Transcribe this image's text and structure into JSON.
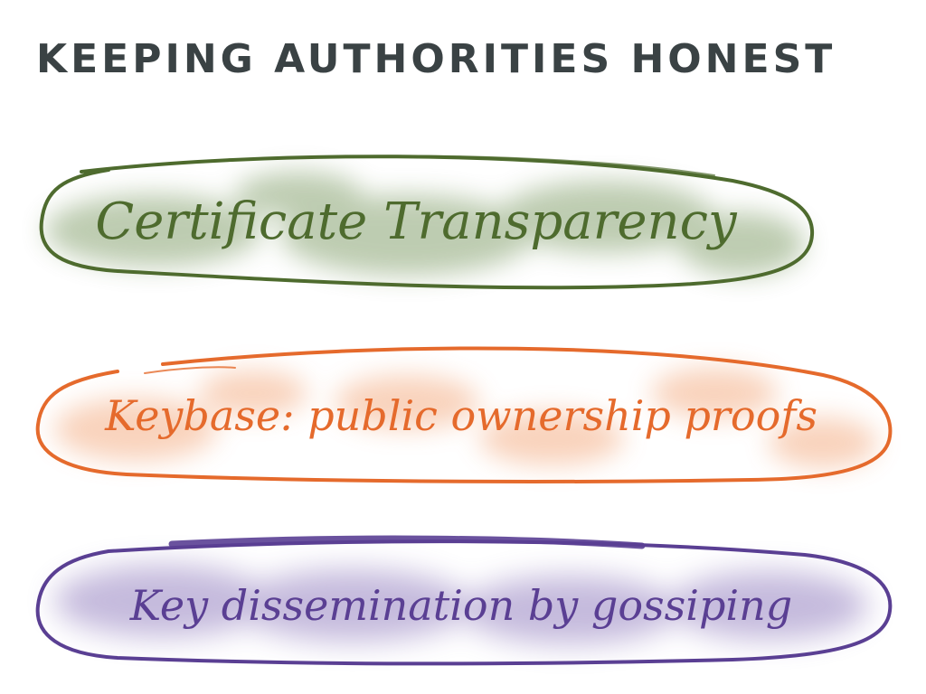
{
  "title": "KEEPING AUTHORITIES HONEST",
  "items": [
    {
      "label": "Certificate Transparency",
      "color": "#4e6b2e",
      "fill": "#6e8f52"
    },
    {
      "label": "Keybase: public ownership proofs",
      "color": "#e56a2c",
      "fill": "#f0925a"
    },
    {
      "label": "Key dissemination by gossiping",
      "color": "#5a3f93",
      "fill": "#7f67b3"
    }
  ]
}
